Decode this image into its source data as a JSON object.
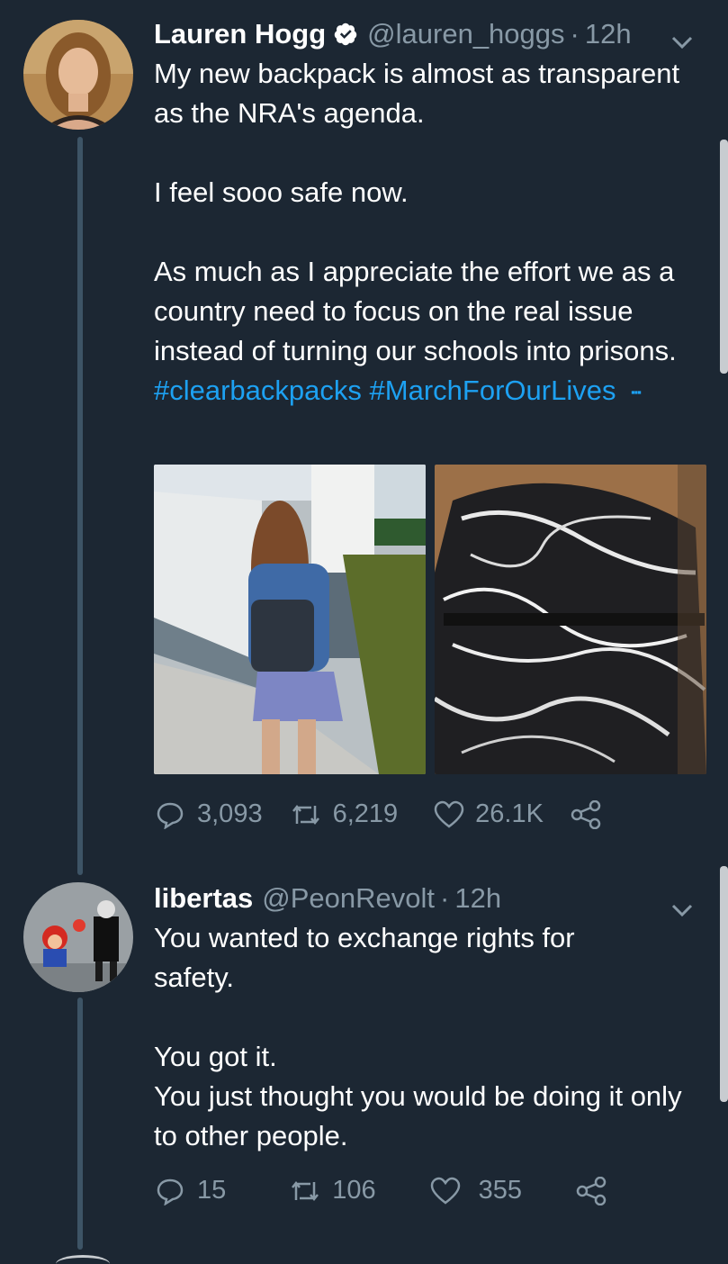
{
  "tweets": [
    {
      "name": "Lauren Hogg",
      "verified": true,
      "handle": "@lauren_hoggs",
      "separator": "·",
      "time": "12h",
      "paragraphs": [
        "My new backpack is almost as transparent as the NRA's agenda.",
        "I feel sooo safe now.",
        "As much as I appreciate the effort we as a country need to focus on the real issue instead of turning our schools into prisons."
      ],
      "hashtags": [
        "#clearbackpacks",
        "#MarchForOurLives"
      ],
      "media": [
        "photo of girl walking with clear backpack",
        "close-up of clear backpack"
      ],
      "actions": {
        "replies": "3,093",
        "retweets": "6,219",
        "likes": "26.1K"
      }
    },
    {
      "name": "libertas",
      "verified": false,
      "handle": "@PeonRevolt",
      "separator": "·",
      "time": "12h",
      "paragraphs": [
        "You wanted to exchange rights for safety.",
        "You got it.\nYou just thought you would be doing it only to other people."
      ],
      "actions": {
        "replies": "15",
        "retweets": "106",
        "likes": "355"
      }
    }
  ],
  "icons": {
    "verified": "verified-badge-icon",
    "chevron": "chevron-down-icon",
    "reply": "reply-icon",
    "retweet": "retweet-icon",
    "like": "heart-icon",
    "share": "share-icon"
  },
  "colors": {
    "background": "#1c2733",
    "text": "#ffffff",
    "secondary": "#8899a6",
    "link": "#1da1f2",
    "thread_line": "#3d5466"
  }
}
